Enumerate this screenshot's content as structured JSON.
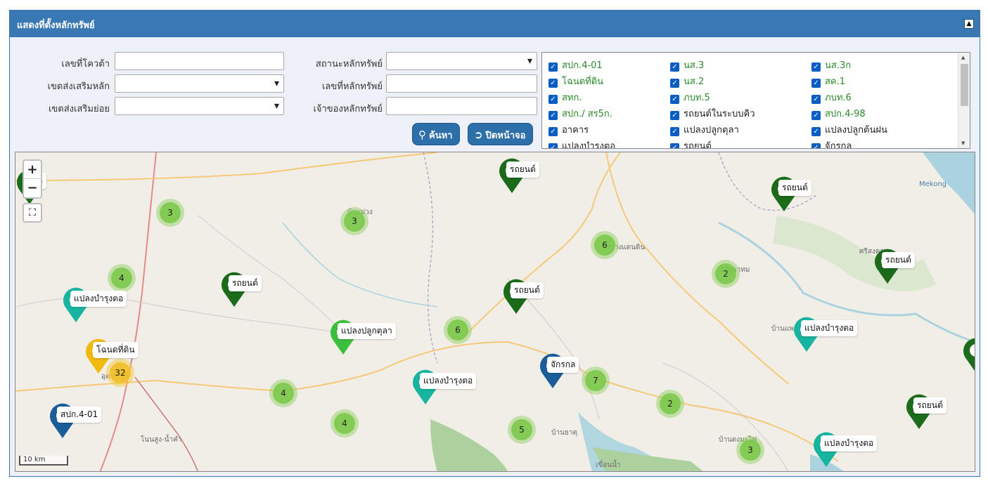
{
  "header": {
    "title": "แสดงที่ตั้งหลักทรัพย์",
    "collapse_icon": "▲"
  },
  "form": {
    "quota_no_label": "เลขที่โควต้า",
    "main_zone_label": "เขตส่งเสริมหลัก",
    "sub_zone_label": "เขตส่งเสริมย่อย",
    "asset_status_label": "สถานะหลักทรัพย์",
    "asset_no_label": "เลขที่หลักทรัพย์",
    "owner_label": "เจ้าของหลักทรัพย์",
    "search_button": "ค้นหา",
    "close_button": "ปิดหน้าจอ"
  },
  "checklist": {
    "items": [
      {
        "label": "สปก.4-01",
        "color": "#2a8a2a"
      },
      {
        "label": "นส.3",
        "color": "#2a8a2a"
      },
      {
        "label": "นส.3ก",
        "color": "#2a8a2a"
      },
      {
        "label": "โฉนดที่ดิน",
        "color": "#2a8a2a"
      },
      {
        "label": "นส.2",
        "color": "#2a8a2a"
      },
      {
        "label": "สค.1",
        "color": "#2a8a2a"
      },
      {
        "label": "สทก.",
        "color": "#2a8a2a"
      },
      {
        "label": "ภบท.5",
        "color": "#2a8a2a"
      },
      {
        "label": "ภบท.6",
        "color": "#2a8a2a"
      },
      {
        "label": "สปก./ สร5ก.",
        "color": "#2a8a2a"
      },
      {
        "label": "รถยนต์ในระบบคิว",
        "color": "#222222"
      },
      {
        "label": "สปก.4-98",
        "color": "#2a8a2a"
      },
      {
        "label": "อาคาร",
        "color": "#222222"
      },
      {
        "label": "แปลงปลูกตุลา",
        "color": "#222222"
      },
      {
        "label": "แปลงปลูกต้นฝน",
        "color": "#222222"
      },
      {
        "label": "แปลงบำรุงตอ",
        "color": "#222222"
      },
      {
        "label": "รถยนต์",
        "color": "#222222"
      },
      {
        "label": "จักรกล",
        "color": "#222222"
      }
    ]
  },
  "map": {
    "zoom_in": "+",
    "zoom_out": "−",
    "fullscreen_icon": "⛶",
    "scale": "10 km",
    "place_names": [
      "Mekong",
      "ศรีสงคราม",
      "บ้านม่วง",
      "สว่างแดนดิน",
      "บ้านนาทม",
      "บ้านแพง",
      "บ้านธาตุ",
      "บ้านดงมะไฟ",
      "โนนสูง-น้ำคำ",
      "อุดรธานี",
      "บ้านนาทม",
      "เขื่อนนํ้า"
    ],
    "clusters": [
      {
        "count": "3"
      },
      {
        "count": "3"
      },
      {
        "count": "6"
      },
      {
        "count": "4"
      },
      {
        "count": "2"
      },
      {
        "count": "6"
      },
      {
        "count": "32"
      },
      {
        "count": "7"
      },
      {
        "count": "4"
      },
      {
        "count": "2"
      },
      {
        "count": "4"
      },
      {
        "count": "5"
      },
      {
        "count": "3"
      }
    ],
    "markers": [
      {
        "label": "รถยนต์",
        "color": "#1b6b1b"
      },
      {
        "label": "รถยนต์",
        "color": "#1b6b1b"
      },
      {
        "label": "รถยนต์",
        "color": "#1b6b1b"
      },
      {
        "label": "รถยนต์",
        "color": "#1b6b1b"
      },
      {
        "label": "รถยนต์",
        "color": "#1b6b1b"
      },
      {
        "label": "รถยนต์",
        "color": "#1b6b1b"
      },
      {
        "label": "แปลงบำรุงตอ",
        "color": "#17b5a0"
      },
      {
        "label": "แปลงปลูกตุลา",
        "color": "#3cbf3c"
      },
      {
        "label": "โฉนดที่ดิน",
        "color": "#f2b90f"
      },
      {
        "label": "แปลงบำรุงตอ",
        "color": "#17b5a0"
      },
      {
        "label": "จักรกล",
        "color": "#1a5e99"
      },
      {
        "label": "แปลงบำรุงตอ",
        "color": "#17b5a0"
      },
      {
        "label": "สปก.4-01",
        "color": "#1a5e99"
      },
      {
        "label": "รถยนต์",
        "color": "#1b6b1b"
      },
      {
        "label": "แปลงบำรุงตอ",
        "color": "#17b5a0"
      },
      {
        "label": "นต์",
        "color": "#1b6b1b"
      }
    ]
  }
}
